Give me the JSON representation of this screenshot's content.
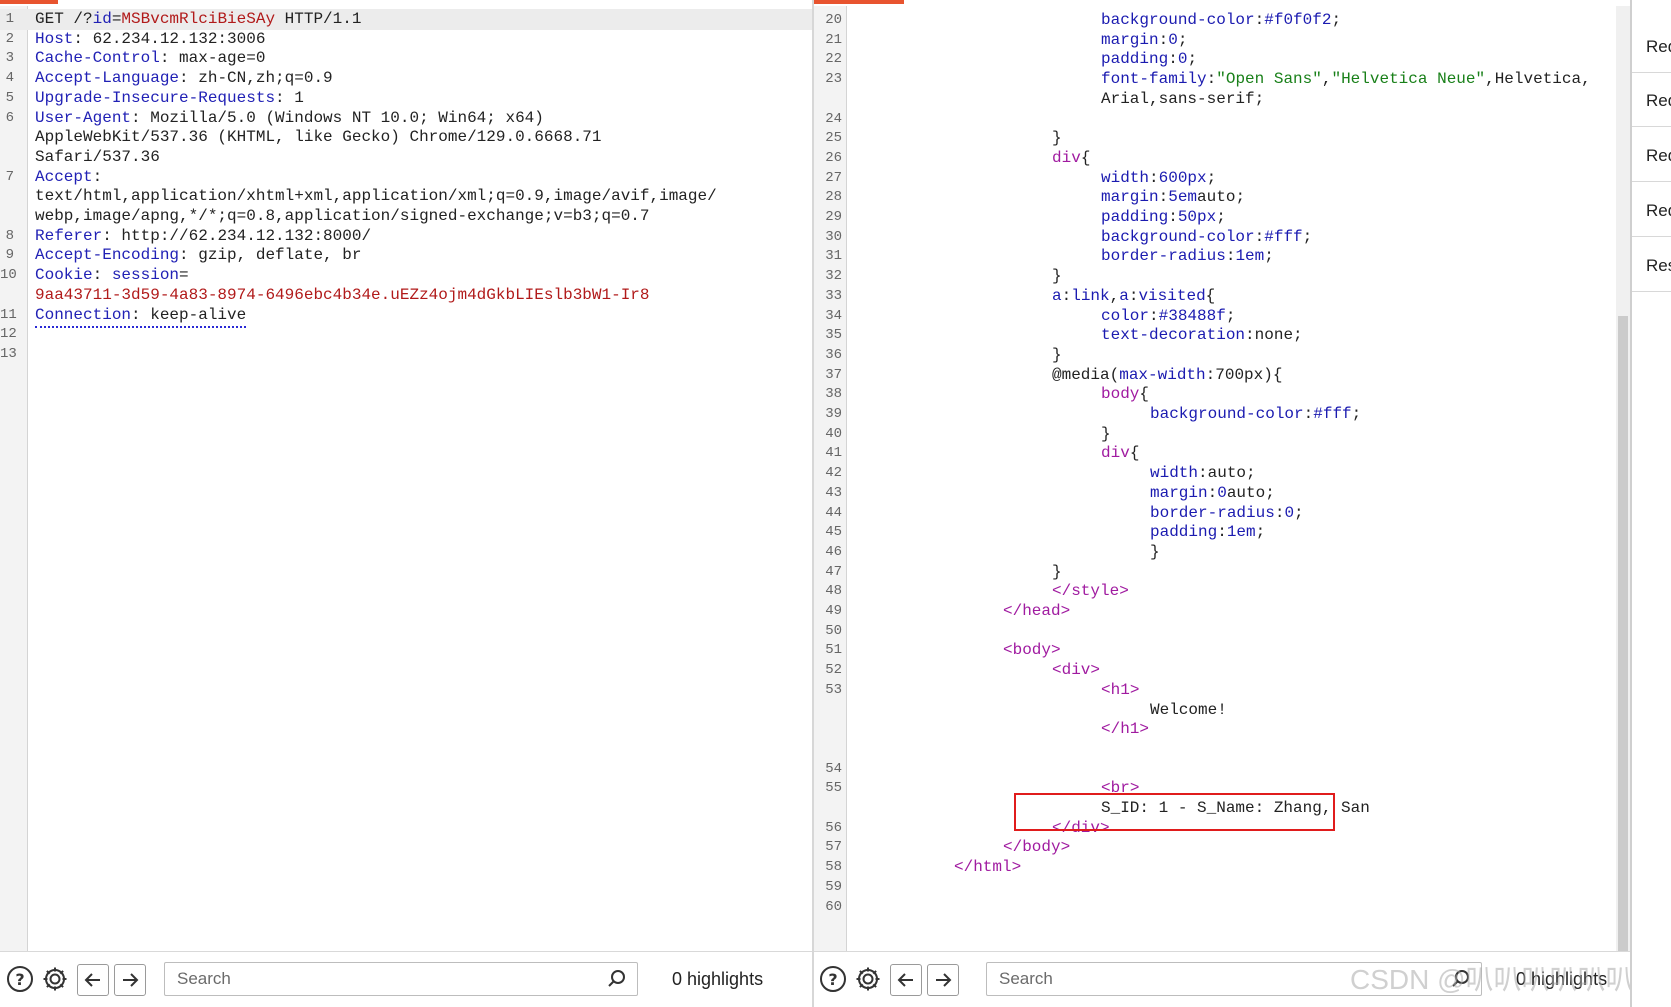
{
  "request": {
    "lines": [
      {
        "n": "1",
        "segs": [
          [
            "v",
            "GET /?"
          ],
          [
            "k",
            "id"
          ],
          [
            "v",
            "="
          ],
          [
            "r",
            "MSBvcmRlciBieSAy"
          ],
          [
            "v",
            " HTTP/1.1"
          ]
        ]
      },
      {
        "n": "2",
        "segs": [
          [
            "k",
            "Host"
          ],
          [
            "v",
            ": 62.234.12.132:3006"
          ]
        ]
      },
      {
        "n": "3",
        "segs": [
          [
            "k",
            "Cache-Control"
          ],
          [
            "v",
            ": max-age=0"
          ]
        ]
      },
      {
        "n": "4",
        "segs": [
          [
            "k",
            "Accept-Language"
          ],
          [
            "v",
            ": zh-CN,zh;q=0.9"
          ]
        ]
      },
      {
        "n": "5",
        "segs": [
          [
            "k",
            "Upgrade-Insecure-Requests"
          ],
          [
            "v",
            ": 1"
          ]
        ]
      },
      {
        "n": "6",
        "segs": [
          [
            "k",
            "User-Agent"
          ],
          [
            "v",
            ": Mozilla/5.0 (Windows NT 10.0; Win64; x64)"
          ]
        ]
      },
      {
        "n": "",
        "segs": [
          [
            "v",
            "AppleWebKit/537.36 (KHTML, like Gecko) Chrome/129.0.6668.71"
          ]
        ]
      },
      {
        "n": "",
        "segs": [
          [
            "v",
            "Safari/537.36"
          ]
        ]
      },
      {
        "n": "7",
        "segs": [
          [
            "k",
            "Accept"
          ],
          [
            "v",
            ":"
          ]
        ]
      },
      {
        "n": "",
        "segs": [
          [
            "v",
            "text/html,application/xhtml+xml,application/xml;q=0.9,image/avif,image/"
          ]
        ]
      },
      {
        "n": "",
        "segs": [
          [
            "v",
            "webp,image/apng,*/*;q=0.8,application/signed-exchange;v=b3;q=0.7"
          ]
        ]
      },
      {
        "n": "8",
        "segs": [
          [
            "k",
            "Referer"
          ],
          [
            "v",
            ": http://62.234.12.132:8000/"
          ]
        ]
      },
      {
        "n": "9",
        "segs": [
          [
            "k",
            "Accept-Encoding"
          ],
          [
            "v",
            ": gzip, deflate, br"
          ]
        ]
      },
      {
        "n": "10",
        "segs": [
          [
            "k",
            "Cookie"
          ],
          [
            "v",
            ": "
          ],
          [
            "k",
            "session"
          ],
          [
            "v",
            "="
          ]
        ]
      },
      {
        "n": "",
        "segs": [
          [
            "r",
            "9aa43711-3d59-4a83-8974-6496ebc4b34e.uEZz4ojm4dGkbLIEslb3bW1-Ir8"
          ]
        ]
      },
      {
        "n": "11",
        "segs": [
          [
            "k",
            "Connection"
          ],
          [
            "v",
            ": keep-alive"
          ]
        ],
        "dotted": true
      },
      {
        "n": "12",
        "segs": []
      },
      {
        "n": "13",
        "segs": []
      }
    ]
  },
  "response": {
    "lines": [
      {
        "n": "20",
        "i": 5,
        "segs": [
          [
            "prop",
            "background-color"
          ],
          [
            "v",
            ":"
          ],
          [
            "num",
            "#f0f0f2"
          ],
          [
            "v",
            ";"
          ]
        ]
      },
      {
        "n": "21",
        "i": 5,
        "segs": [
          [
            "prop",
            "margin"
          ],
          [
            "v",
            ":"
          ],
          [
            "num",
            "0"
          ],
          [
            "v",
            ";"
          ]
        ]
      },
      {
        "n": "22",
        "i": 5,
        "segs": [
          [
            "prop",
            "padding"
          ],
          [
            "v",
            ":"
          ],
          [
            "num",
            "0"
          ],
          [
            "v",
            ";"
          ]
        ]
      },
      {
        "n": "23",
        "i": 5,
        "segs": [
          [
            "prop",
            "font-family"
          ],
          [
            "v",
            ":"
          ],
          [
            "str",
            "\"Open Sans\""
          ],
          [
            "v",
            ","
          ],
          [
            "str",
            "\"Helvetica Neue\""
          ],
          [
            "v",
            ",Helvetica,"
          ]
        ]
      },
      {
        "n": "",
        "i": 5,
        "segs": [
          [
            "v",
            "Arial,sans-serif;"
          ]
        ]
      },
      {
        "n": "24",
        "i": 0,
        "segs": []
      },
      {
        "n": "25",
        "i": 4,
        "segs": [
          [
            "v",
            "}"
          ]
        ]
      },
      {
        "n": "26",
        "i": 4,
        "segs": [
          [
            "tag",
            "div"
          ],
          [
            "v",
            "{"
          ]
        ]
      },
      {
        "n": "27",
        "i": 5,
        "segs": [
          [
            "prop",
            "width"
          ],
          [
            "v",
            ":"
          ],
          [
            "num",
            "600px"
          ],
          [
            "v",
            ";"
          ]
        ]
      },
      {
        "n": "28",
        "i": 5,
        "segs": [
          [
            "prop",
            "margin"
          ],
          [
            "v",
            ":"
          ],
          [
            "num",
            "5em"
          ],
          [
            "v",
            "auto;"
          ]
        ]
      },
      {
        "n": "29",
        "i": 5,
        "segs": [
          [
            "prop",
            "padding"
          ],
          [
            "v",
            ":"
          ],
          [
            "num",
            "50px"
          ],
          [
            "v",
            ";"
          ]
        ]
      },
      {
        "n": "30",
        "i": 5,
        "segs": [
          [
            "prop",
            "background-color"
          ],
          [
            "v",
            ":"
          ],
          [
            "num",
            "#fff"
          ],
          [
            "v",
            ";"
          ]
        ]
      },
      {
        "n": "31",
        "i": 5,
        "segs": [
          [
            "prop",
            "border-radius"
          ],
          [
            "v",
            ":"
          ],
          [
            "num",
            "1em"
          ],
          [
            "v",
            ";"
          ]
        ]
      },
      {
        "n": "32",
        "i": 4,
        "segs": [
          [
            "v",
            "}"
          ]
        ]
      },
      {
        "n": "33",
        "i": 4,
        "segs": [
          [
            "prop",
            "a"
          ],
          [
            "v",
            ":"
          ],
          [
            "prop",
            "link"
          ],
          [
            "v",
            ","
          ],
          [
            "prop",
            "a"
          ],
          [
            "v",
            ":"
          ],
          [
            "prop",
            "visited"
          ],
          [
            "v",
            "{"
          ]
        ]
      },
      {
        "n": "34",
        "i": 5,
        "segs": [
          [
            "prop",
            "color"
          ],
          [
            "v",
            ":"
          ],
          [
            "num",
            "#38488f"
          ],
          [
            "v",
            ";"
          ]
        ]
      },
      {
        "n": "35",
        "i": 5,
        "segs": [
          [
            "prop",
            "text-decoration"
          ],
          [
            "v",
            ":none;"
          ]
        ]
      },
      {
        "n": "36",
        "i": 4,
        "segs": [
          [
            "v",
            "}"
          ]
        ]
      },
      {
        "n": "37",
        "i": 4,
        "segs": [
          [
            "v",
            "@media("
          ],
          [
            "prop",
            "max-width"
          ],
          [
            "v",
            ":700px){"
          ]
        ]
      },
      {
        "n": "38",
        "i": 5,
        "segs": [
          [
            "tag",
            "body"
          ],
          [
            "v",
            "{"
          ]
        ]
      },
      {
        "n": "39",
        "i": 6,
        "segs": [
          [
            "prop",
            "background-color"
          ],
          [
            "v",
            ":"
          ],
          [
            "num",
            "#fff"
          ],
          [
            "v",
            ";"
          ]
        ]
      },
      {
        "n": "40",
        "i": 5,
        "segs": [
          [
            "v",
            "}"
          ]
        ]
      },
      {
        "n": "41",
        "i": 5,
        "segs": [
          [
            "tag",
            "div"
          ],
          [
            "v",
            "{"
          ]
        ]
      },
      {
        "n": "42",
        "i": 6,
        "segs": [
          [
            "prop",
            "width"
          ],
          [
            "v",
            ":auto;"
          ]
        ]
      },
      {
        "n": "43",
        "i": 6,
        "segs": [
          [
            "prop",
            "margin"
          ],
          [
            "v",
            ":"
          ],
          [
            "num",
            "0"
          ],
          [
            "v",
            "auto;"
          ]
        ]
      },
      {
        "n": "44",
        "i": 6,
        "segs": [
          [
            "prop",
            "border-radius"
          ],
          [
            "v",
            ":"
          ],
          [
            "num",
            "0"
          ],
          [
            "v",
            ";"
          ]
        ]
      },
      {
        "n": "45",
        "i": 6,
        "segs": [
          [
            "prop",
            "padding"
          ],
          [
            "v",
            ":"
          ],
          [
            "num",
            "1em"
          ],
          [
            "v",
            ";"
          ]
        ]
      },
      {
        "n": "46",
        "i": 6,
        "segs": [
          [
            "v",
            "}"
          ]
        ]
      },
      {
        "n": "47",
        "i": 4,
        "segs": [
          [
            "v",
            "}"
          ]
        ]
      },
      {
        "n": "48",
        "i": 4,
        "segs": [
          [
            "tag",
            "</style"
          ],
          [
            "tag",
            ">"
          ]
        ]
      },
      {
        "n": "49",
        "i": 3,
        "segs": [
          [
            "tag",
            "</head"
          ],
          [
            "tag",
            ">"
          ]
        ]
      },
      {
        "n": "50",
        "i": 0,
        "segs": []
      },
      {
        "n": "51",
        "i": 3,
        "segs": [
          [
            "tag",
            "<body"
          ],
          [
            "tag",
            ">"
          ]
        ]
      },
      {
        "n": "52",
        "i": 4,
        "segs": [
          [
            "tag",
            "<div"
          ],
          [
            "tag",
            ">"
          ]
        ]
      },
      {
        "n": "53",
        "i": 5,
        "segs": [
          [
            "tag",
            "<h1"
          ],
          [
            "tag",
            ">"
          ]
        ]
      },
      {
        "n": "",
        "i": 6,
        "segs": [
          [
            "v",
            "Welcome!"
          ]
        ]
      },
      {
        "n": "",
        "i": 5,
        "segs": [
          [
            "tag",
            "</h1"
          ],
          [
            "tag",
            ">"
          ]
        ]
      },
      {
        "n": "",
        "i": 0,
        "segs": []
      },
      {
        "n": "54",
        "i": 0,
        "segs": []
      },
      {
        "n": "55",
        "i": 5,
        "segs": [
          [
            "tag",
            "<br"
          ],
          [
            "tag",
            ">"
          ]
        ]
      },
      {
        "n": "",
        "i": 5,
        "segs": [
          [
            "v",
            "S_ID: 1 - S_Name: Zhang, San"
          ]
        ],
        "boxed": true
      },
      {
        "n": "56",
        "i": 4,
        "segs": [
          [
            "tag",
            "</div"
          ],
          [
            "tag",
            ">"
          ]
        ]
      },
      {
        "n": "57",
        "i": 3,
        "segs": [
          [
            "tag",
            "</body"
          ],
          [
            "tag",
            ">"
          ]
        ]
      },
      {
        "n": "58",
        "i": 2,
        "segs": [
          [
            "tag",
            "</html"
          ],
          [
            "tag",
            ">"
          ]
        ]
      },
      {
        "n": "59",
        "i": 0,
        "segs": []
      },
      {
        "n": "60",
        "i": 0,
        "segs": []
      }
    ]
  },
  "toolbar_left": {
    "search_placeholder": "Search",
    "highlights": "0 highlights"
  },
  "toolbar_right": {
    "search_placeholder": "Search",
    "highlights": "0 highlights"
  },
  "side_tabs": [
    "Req",
    "Req",
    "Req",
    "Req",
    "Res"
  ],
  "watermark": "CSDN @叭叭叭叭叭叭叭",
  "colors": {
    "accent": "#e8542f",
    "header_key": "#2121b5",
    "param_value": "#b11a1a",
    "html_tag": "#a01ba0",
    "css_string": "#198019",
    "highlight_box": "#e01c1c"
  },
  "icons": [
    "help-icon",
    "gear-icon",
    "arrow-left-icon",
    "arrow-right-icon",
    "search-icon"
  ]
}
